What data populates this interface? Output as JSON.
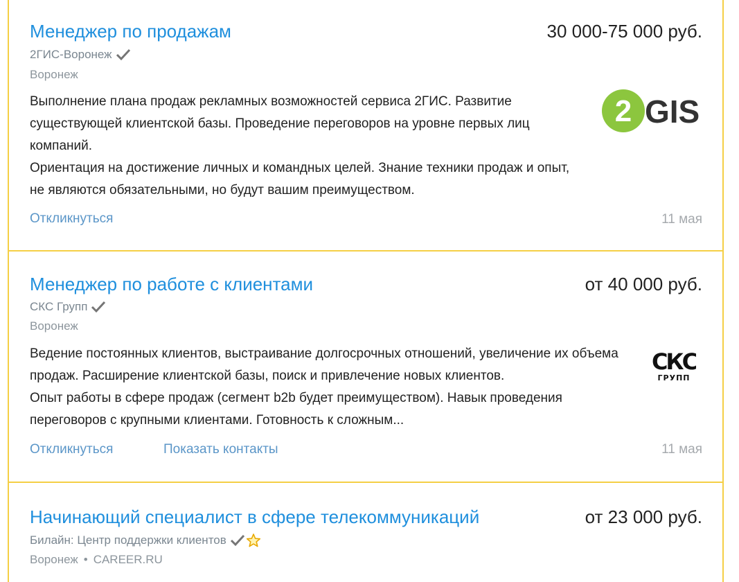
{
  "vacancies": [
    {
      "title": "Менеджер по продажам",
      "salary": "30 000-75 000 руб.",
      "company": "2ГИС-Воронеж",
      "city": "Воронеж",
      "description": [
        "Выполнение плана продаж рекламных возможностей сервиса 2ГИС. Развитие существующей клиентской базы. Проведение переговоров на уровне первых лиц компаний.",
        "Ориентация на достижение личных и командных целей. Знание техники продаж и опыт, не являются обязательными, но будут вашим преимуществом."
      ],
      "respond_label": "Откликнуться",
      "date": "11 мая",
      "logo_text": "GIS",
      "logo_digit": "2"
    },
    {
      "title": "Менеджер по работе с клиентами",
      "salary": "от 40 000 руб.",
      "company": "СКС Групп",
      "city": "Воронеж",
      "description": [
        "Ведение постоянных клиентов, выстраивание долгосрочных отношений, увеличение их объема продаж. Расширение клиентской базы, поиск и привлечение новых клиентов.",
        "Опыт работы в сфере продаж (сегмент b2b будет преимуществом). Навык проведения переговоров с крупными клиентами. Готовность к сложным..."
      ],
      "respond_label": "Откликнуться",
      "contacts_label": "Показать контакты",
      "date": "11 мая",
      "logo_text": "СКС",
      "logo_subtext": "ГРУПП"
    },
    {
      "title": "Начинающий специалист в сфере телекоммуникаций",
      "salary": "от 23 000 руб.",
      "company": "Билайн: Центр поддержки клиентов",
      "city": "Воронеж",
      "source": "CAREER.RU"
    }
  ],
  "colors": {
    "title": "#1f8fdd",
    "border": "#f5cf45",
    "link": "#5b96c8",
    "gis_green": "#8cc63e"
  },
  "icons": [
    "verified-check-icon",
    "star-icon"
  ]
}
